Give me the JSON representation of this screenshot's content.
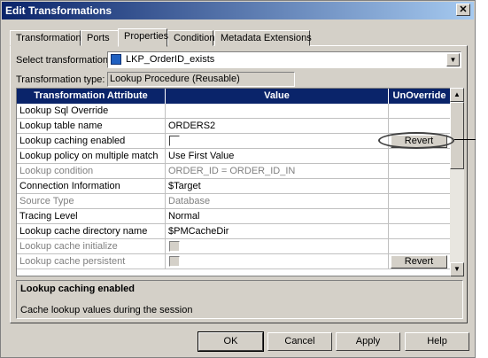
{
  "window": {
    "title": "Edit Transformations",
    "close_glyph": "✕"
  },
  "tabs": [
    {
      "label": "Transformation"
    },
    {
      "label": "Ports"
    },
    {
      "label": "Properties",
      "active": true
    },
    {
      "label": "Condition"
    },
    {
      "label": "Metadata Extensions"
    }
  ],
  "select_transformation": {
    "label": "Select transformation:",
    "value": "LKP_OrderID_exists",
    "dropdown_glyph": "▼"
  },
  "transformation_type": {
    "label": "Transformation type:",
    "value": "Lookup Procedure (Reusable)"
  },
  "grid": {
    "headers": {
      "attribute": "Transformation Attribute",
      "value": "Value",
      "unoverride": "UnOverride"
    },
    "rows": [
      {
        "attribute": "Lookup Sql Override",
        "value": ""
      },
      {
        "attribute": "Lookup table name",
        "value": "ORDERS2"
      },
      {
        "attribute": "Lookup caching enabled",
        "value": "",
        "checkbox": true,
        "revert": "Revert"
      },
      {
        "attribute": "Lookup policy on multiple match",
        "value": "Use First Value"
      },
      {
        "attribute": "Lookup condition",
        "value": "ORDER_ID = ORDER_ID_IN",
        "disabled": true
      },
      {
        "attribute": "Connection Information",
        "value": "$Target"
      },
      {
        "attribute": "Source Type",
        "value": "Database",
        "disabled": true
      },
      {
        "attribute": "Tracing Level",
        "value": "Normal"
      },
      {
        "attribute": "Lookup cache directory name",
        "value": "$PMCacheDir"
      },
      {
        "attribute": "Lookup cache initialize",
        "value": "",
        "checkbox": true,
        "disabled": true
      },
      {
        "attribute": "Lookup cache persistent",
        "value": "",
        "checkbox": true,
        "disabled": true,
        "revert": "Revert"
      }
    ]
  },
  "scrollbar": {
    "up_glyph": "▲",
    "down_glyph": "▼"
  },
  "description": {
    "title": "Lookup caching enabled",
    "text": "Cache lookup values during the session"
  },
  "buttons": {
    "ok": "OK",
    "cancel": "Cancel",
    "apply": "Apply",
    "help": "Help"
  }
}
